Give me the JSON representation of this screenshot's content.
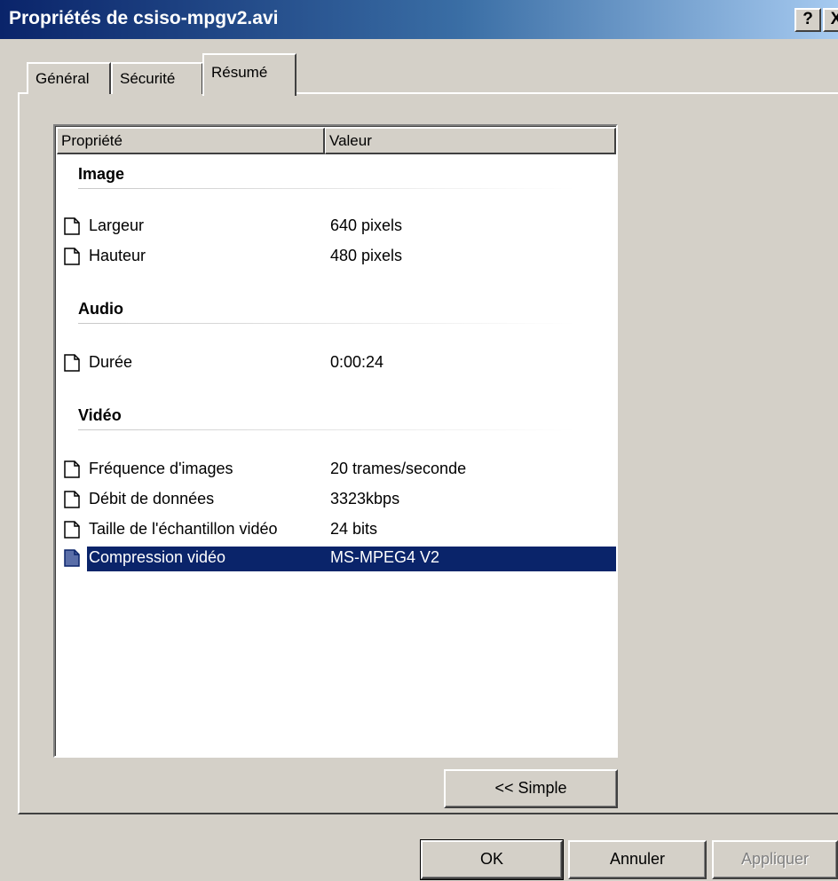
{
  "window": {
    "title": "Propriétés de csiso-mpgv2.avi",
    "help_label": "?",
    "close_label": "X"
  },
  "tabs": [
    {
      "label": "Général",
      "active": false
    },
    {
      "label": "Sécurité",
      "active": false
    },
    {
      "label": "Résumé",
      "active": true
    }
  ],
  "list": {
    "headers": {
      "property": "Propriété",
      "value": "Valeur"
    },
    "groups": [
      {
        "name": "Image",
        "rows": [
          {
            "property": "Largeur",
            "value": "640 pixels"
          },
          {
            "property": "Hauteur",
            "value": "480 pixels"
          }
        ]
      },
      {
        "name": "Audio",
        "rows": [
          {
            "property": "Durée",
            "value": "0:00:24"
          }
        ]
      },
      {
        "name": "Vidéo",
        "rows": [
          {
            "property": "Fréquence d'images",
            "value": "20 trames/seconde"
          },
          {
            "property": "Débit de données",
            "value": "3323kbps"
          },
          {
            "property": "Taille de l'échantillon vidéo",
            "value": "24 bits"
          },
          {
            "property": "Compression vidéo",
            "value": "MS-MPEG4 V2",
            "selected": true
          }
        ]
      }
    ]
  },
  "buttons": {
    "simple": "<< Simple",
    "ok": "OK",
    "cancel": "Annuler",
    "apply": "Appliquer"
  },
  "icons": {
    "property_row": "document-icon"
  },
  "colors": {
    "titlebar_start": "#0a246a",
    "titlebar_end": "#a6caf0",
    "selection": "#0a246a",
    "face": "#d4d0c8"
  }
}
